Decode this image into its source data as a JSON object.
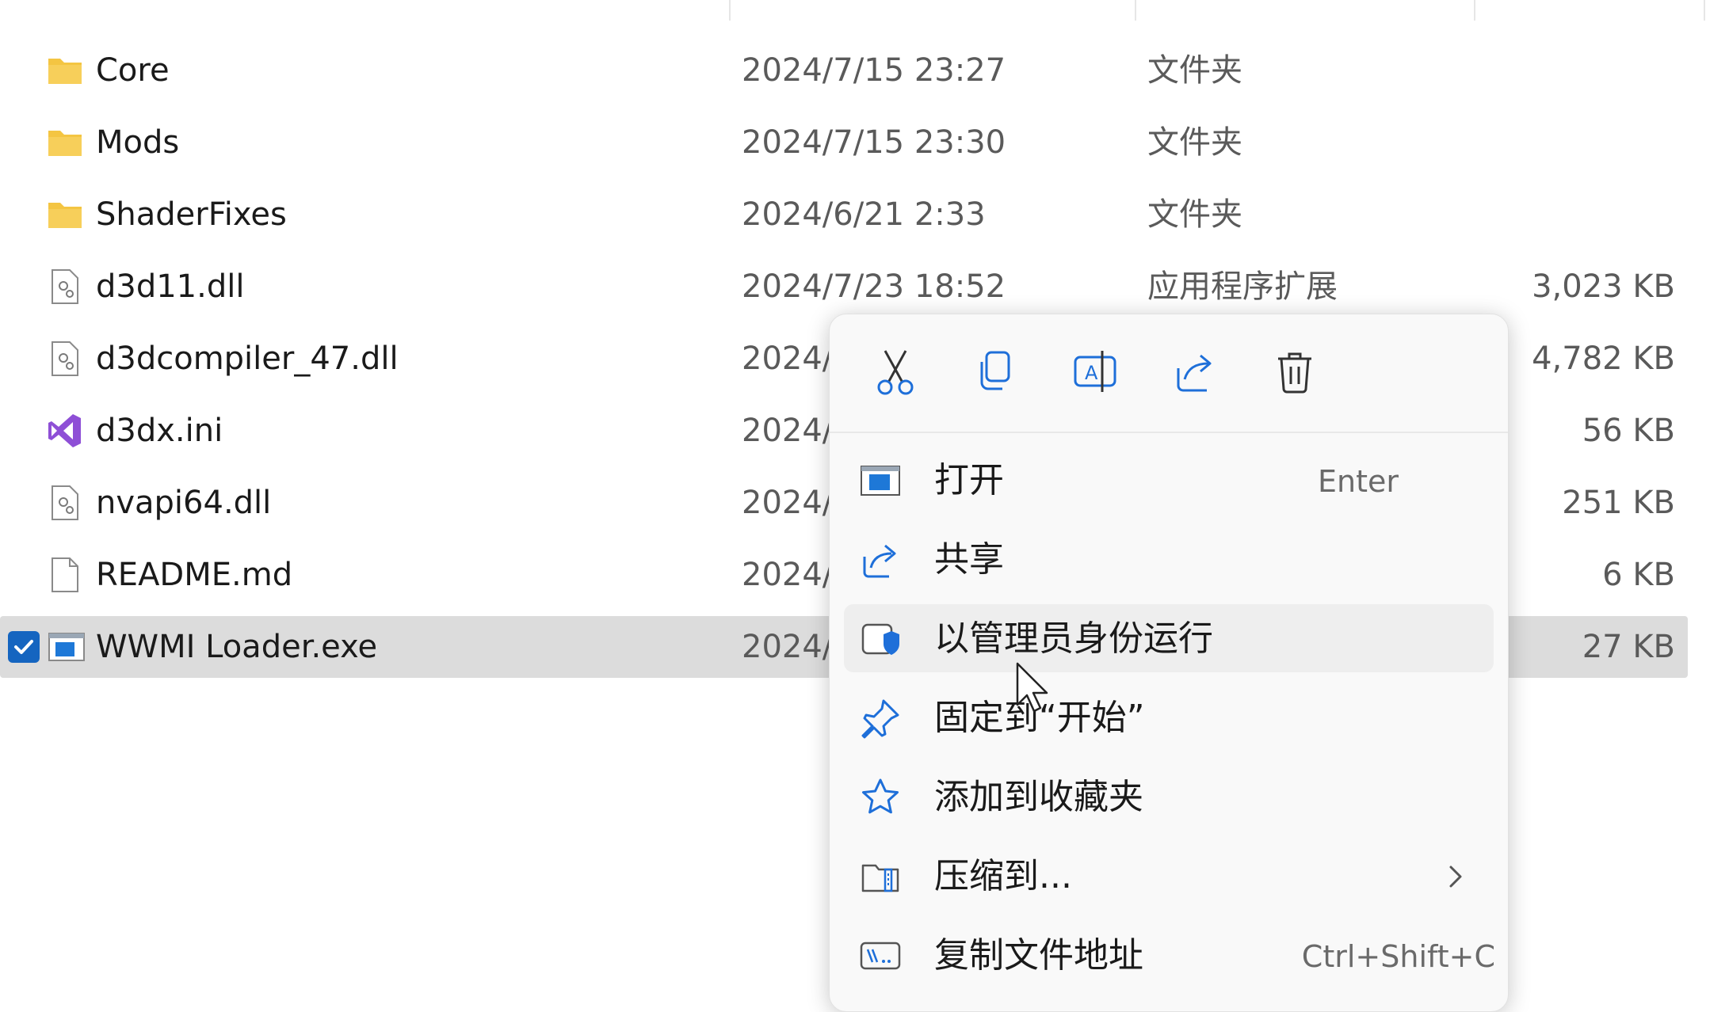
{
  "files": [
    {
      "name": "Core",
      "date": "2024/7/15 23:27",
      "type": "文件夹",
      "size": "",
      "icon": "folder-icon"
    },
    {
      "name": "Mods",
      "date": "2024/7/15 23:30",
      "type": "文件夹",
      "size": "",
      "icon": "folder-icon"
    },
    {
      "name": "ShaderFixes",
      "date": "2024/6/21 2:33",
      "type": "文件夹",
      "size": "",
      "icon": "folder-icon"
    },
    {
      "name": "d3d11.dll",
      "date": "2024/7/23 18:52",
      "type": "应用程序扩展",
      "size": "3,023 KB",
      "icon": "dll-file-icon"
    },
    {
      "name": "d3dcompiler_47.dll",
      "date": "2024/",
      "type": "",
      "size": "4,782 KB",
      "icon": "dll-file-icon"
    },
    {
      "name": "d3dx.ini",
      "date": "2024/",
      "type": "",
      "size": "56 KB",
      "icon": "visual-studio-icon"
    },
    {
      "name": "nvapi64.dll",
      "date": "2024/",
      "type": "",
      "size": "251 KB",
      "icon": "dll-file-icon"
    },
    {
      "name": "README.md",
      "date": "2024/",
      "type": "",
      "size": "6 KB",
      "icon": "blank-file-icon"
    },
    {
      "name": "WWMI Loader.exe",
      "date": "2024/",
      "type": "",
      "size": "27 KB",
      "icon": "exe-file-icon",
      "selected": true
    }
  ],
  "context_menu": {
    "toolbar": [
      "cut-icon",
      "copy-icon",
      "rename-icon",
      "share-icon",
      "delete-icon"
    ],
    "items": [
      {
        "label": "打开",
        "shortcut": "Enter",
        "icon": "open-app-icon"
      },
      {
        "label": "共享",
        "shortcut": "",
        "icon": "share-icon"
      },
      {
        "label": "以管理员身份运行",
        "shortcut": "",
        "icon": "run-as-admin-icon",
        "hover": true
      },
      {
        "label": "固定到“开始”",
        "shortcut": "",
        "icon": "pin-icon"
      },
      {
        "label": "添加到收藏夹",
        "shortcut": "",
        "icon": "star-icon"
      },
      {
        "label": "压缩到...",
        "shortcut": "",
        "icon": "compress-icon",
        "submenu": true
      },
      {
        "label": "复制文件地址",
        "shortcut": "Ctrl+Shift+C",
        "icon": "copy-path-icon"
      }
    ]
  },
  "colors": {
    "accent": "#1565c0",
    "folder": "#f4c542",
    "vs_purple": "#8e4fd6",
    "selected_row": "#dcdcdc"
  }
}
